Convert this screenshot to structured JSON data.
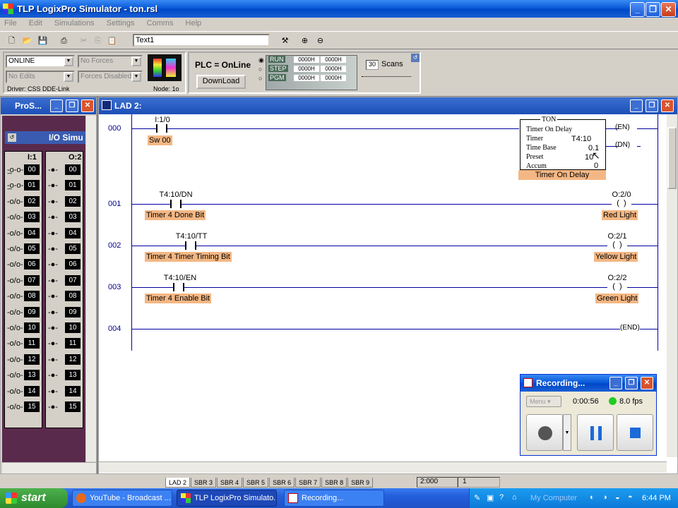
{
  "app": {
    "title": "TLP LogixPro Simulator  -  ton.rsl"
  },
  "menu": [
    "File",
    "Edit",
    "Simulations",
    "Settings",
    "Comms",
    "Help"
  ],
  "toolbar": {
    "text_field": "Text1"
  },
  "status_panel": {
    "mode": "ONLINE",
    "forces": "No Forces",
    "edits": "No Edits",
    "forces_enabled": "Forces Disabled",
    "driver": "Driver: CSS DDE-Link",
    "node": "Node: 1o"
  },
  "plc_panel": {
    "status": "PLC = OnLine",
    "download_label": "DownLoad",
    "modes": [
      "RUN",
      "STEP",
      "PGM"
    ],
    "hex": [
      "0000H",
      "0000H",
      "0000H",
      "0000H",
      "0000H",
      "0000H"
    ],
    "scans_value": "30",
    "scans_label": "Scans"
  },
  "io_window": {
    "title": "ProS...",
    "subtitle": "I/O Simu",
    "col1_header": "I:1",
    "col2_header": "O:2",
    "rows": [
      "00",
      "01",
      "02",
      "03",
      "04",
      "05",
      "06",
      "07",
      "08",
      "09",
      "10",
      "11",
      "12",
      "13",
      "14",
      "15"
    ]
  },
  "ladder_window": {
    "title": "LAD 2:",
    "rungs": [
      {
        "num": "000",
        "addr": "I:1/0",
        "desc": "Sw 00"
      },
      {
        "num": "001",
        "addr": "T4:10/DN",
        "desc": "Timer 4 Done Bit",
        "out_addr": "O:2/0",
        "out_desc": "Red Light"
      },
      {
        "num": "002",
        "addr": "T4:10/TT",
        "desc": "Timer 4 Timer Timing Bit",
        "out_addr": "O:2/1",
        "out_desc": "Yellow Light"
      },
      {
        "num": "003",
        "addr": "T4:10/EN",
        "desc": "Timer 4 Enable Bit",
        "out_addr": "O:2/2",
        "out_desc": "Green Light"
      },
      {
        "num": "004",
        "end_label": "END"
      }
    ],
    "ton": {
      "header": "TON",
      "name": "Timer On Delay",
      "timer_label": "Timer",
      "timer_value": "T4:10",
      "base_label": "Time Base",
      "base_value": "0.1",
      "preset_label": "Preset",
      "preset_value": "10",
      "accum_label": "Accum",
      "accum_value": "0",
      "desc": "Timer On Delay",
      "en": "EN",
      "dn": "DN"
    }
  },
  "tabs": [
    "LAD 2",
    "SBR 3",
    "SBR 4",
    "SBR 5",
    "SBR 6",
    "SBR 7",
    "SBR 8",
    "SBR 9"
  ],
  "statusbar": {
    "pos": "2:000",
    "val": "1"
  },
  "recording": {
    "title": "Recording...",
    "menu_label": "Menu",
    "time": "0:00:56",
    "fps": "8.0 fps"
  },
  "taskbar": {
    "start": "start",
    "items": [
      "YouTube - Broadcast ...",
      "TLP LogixPro Simulato...",
      "Recording..."
    ],
    "mycomputer": "My Computer",
    "clock": "6:44 PM"
  }
}
